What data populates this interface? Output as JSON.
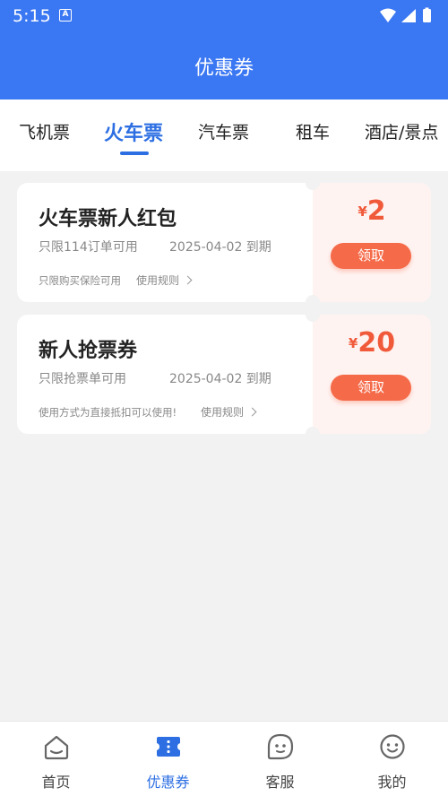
{
  "status_bar": {
    "time": "5:15",
    "a_icon": "A"
  },
  "header": {
    "title": "优惠券"
  },
  "tabs": [
    {
      "label": "飞机票"
    },
    {
      "label": "火车票"
    },
    {
      "label": "汽车票"
    },
    {
      "label": "租车"
    },
    {
      "label": "酒店/景点"
    }
  ],
  "active_tab": "火车票",
  "coupons": [
    {
      "title": "火车票新人红包",
      "limit": "只限114订单可用",
      "date": "2025-04-02 到期",
      "note": "只限购买保险可用",
      "rule_label": "使用规则",
      "currency": "¥",
      "amount": "2",
      "claim_label": "领取"
    },
    {
      "title": "新人抢票券",
      "limit": "只限抢票单可用",
      "date": "2025-04-02 到期",
      "note": "使用方式为直接抵扣可以使用!",
      "rule_label": "使用规则",
      "currency": "¥",
      "amount": "20",
      "claim_label": "领取"
    }
  ],
  "bottom_nav": [
    {
      "label": "首页",
      "icon": "home-icon"
    },
    {
      "label": "优惠券",
      "icon": "coupon-icon"
    },
    {
      "label": "客服",
      "icon": "customer-service-icon"
    },
    {
      "label": "我的",
      "icon": "profile-icon"
    }
  ],
  "colors": {
    "primary": "#3a77f2",
    "tab_active": "#2d6fe3",
    "price": "#f05a3a",
    "claim_button": "#f56a48"
  }
}
